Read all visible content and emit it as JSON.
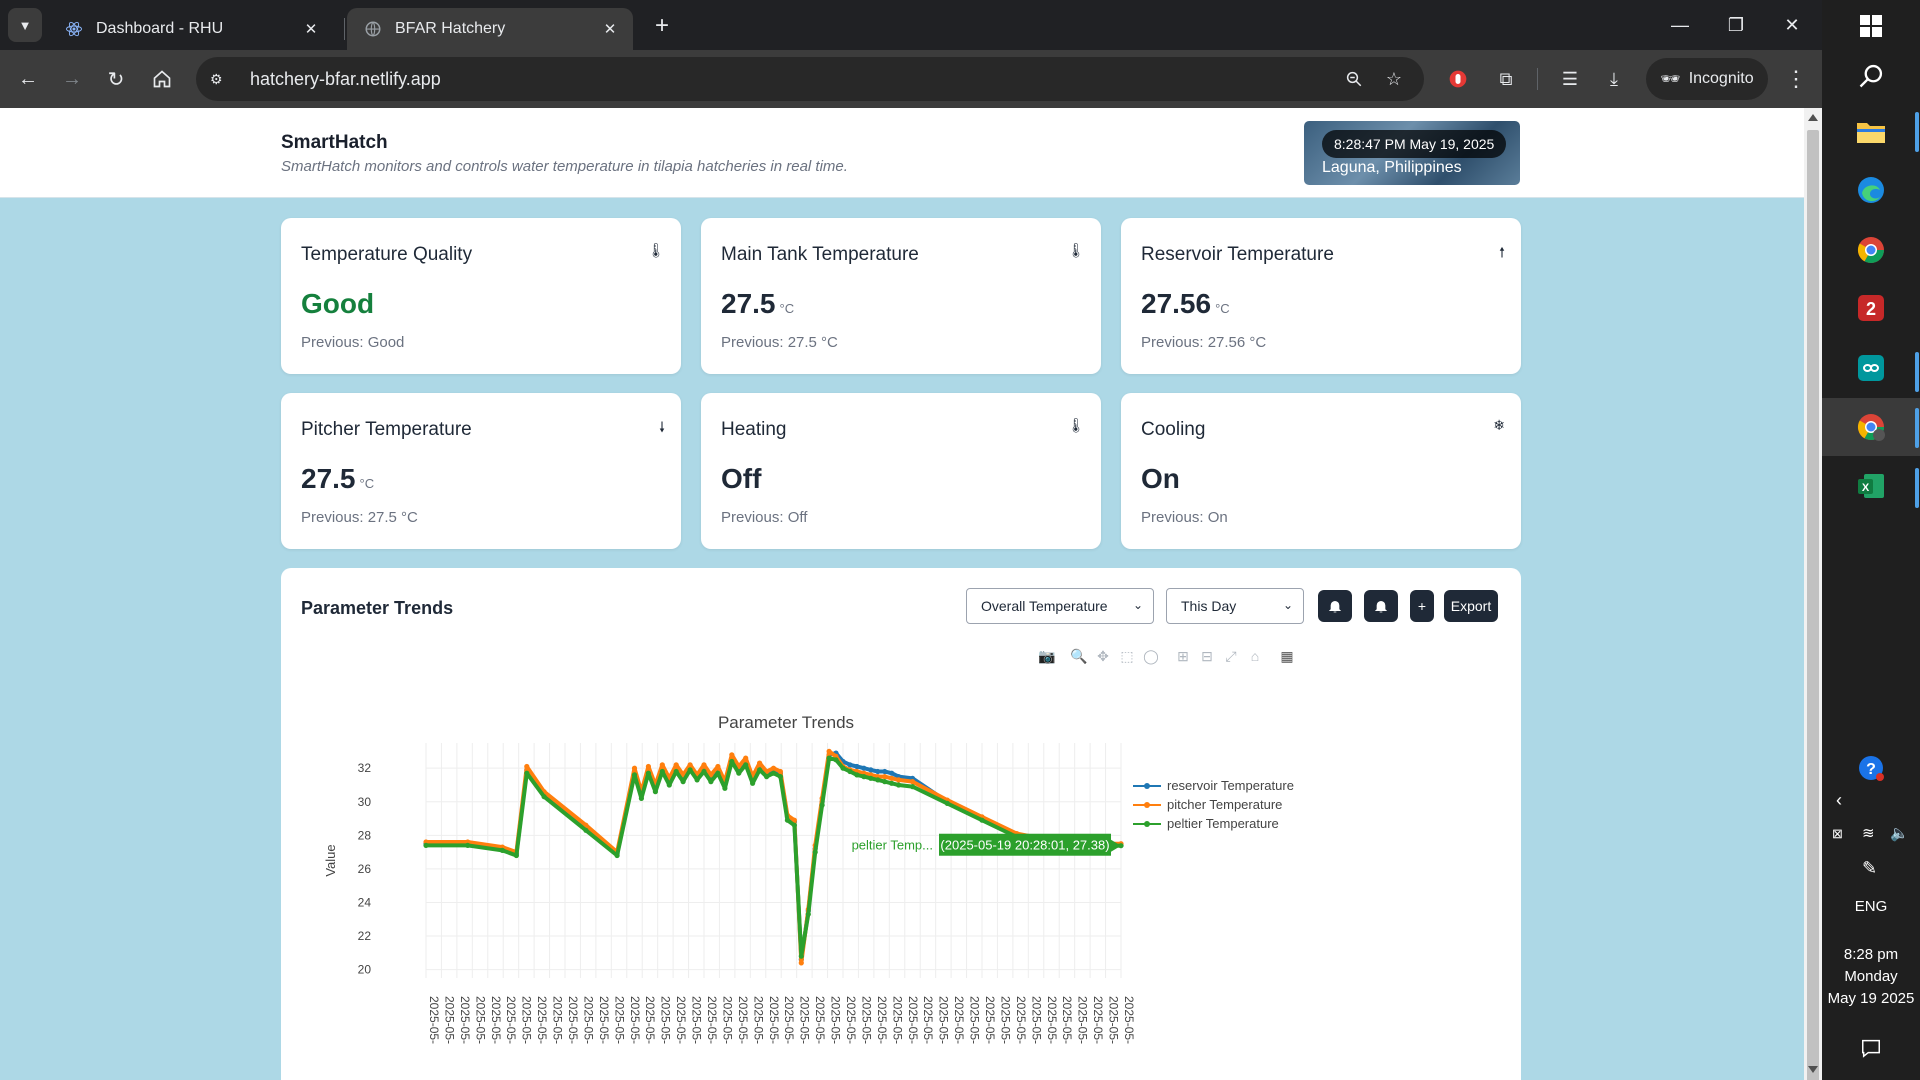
{
  "browser": {
    "tabs": [
      {
        "title": "Dashboard - RHU",
        "favicon": "react-icon"
      },
      {
        "title": "BFAR Hatchery",
        "favicon": "globe-icon"
      }
    ],
    "url": "hatchery-bfar.netlify.app",
    "profile_label": "Incognito"
  },
  "header": {
    "brand": "SmartHatch",
    "tagline": "SmartHatch monitors and controls water temperature in tilapia hatcheries in real time.",
    "datetime": "8:28:47 PM May 19, 2025",
    "location": "Laguna, Philippines"
  },
  "cards": [
    {
      "title": "Temperature Quality",
      "value": "Good",
      "unit": "",
      "previous": "Previous: Good",
      "icon": "thermometer-icon"
    },
    {
      "title": "Main Tank Temperature",
      "value": "27.5",
      "unit": "°C",
      "previous": "Previous: 27.5 °C",
      "icon": "thermometer-icon"
    },
    {
      "title": "Reservoir Temperature",
      "value": "27.56",
      "unit": "°C",
      "previous": "Previous: 27.56 °C",
      "icon": "arrow-up-icon"
    },
    {
      "title": "Pitcher Temperature",
      "value": "27.5",
      "unit": "°C",
      "previous": "Previous: 27.5 °C",
      "icon": "arrow-down-icon"
    },
    {
      "title": "Heating",
      "value": "Off",
      "unit": "",
      "previous": "Previous: Off",
      "icon": "heat-icon"
    },
    {
      "title": "Cooling",
      "value": "On",
      "unit": "",
      "previous": "Previous: On",
      "icon": "snowflake-icon"
    }
  ],
  "trends": {
    "title": "Parameter Trends",
    "parameter_select": "Overall Temperature",
    "range_select": "This Day",
    "add_label": "+",
    "export_label": "Export"
  },
  "chart_data": {
    "type": "line",
    "title": "Parameter Trends",
    "ylabel": "Value",
    "xlabel": "",
    "ylim": [
      19.5,
      33.5
    ],
    "yticks": [
      20,
      22,
      24,
      26,
      28,
      30,
      32
    ],
    "x_tick_label": "2025-05-",
    "x_tick_count": 46,
    "grid": true,
    "legend_position": "top-right",
    "x": [
      0,
      6,
      11,
      13,
      14.5,
      17,
      23,
      27.5,
      30,
      31,
      32,
      33,
      34,
      35,
      36,
      37,
      38,
      39,
      40,
      41,
      42,
      43,
      44,
      45,
      46,
      47,
      48,
      49,
      50,
      51,
      52,
      53,
      54,
      55,
      56,
      57,
      58,
      59,
      60,
      61,
      62,
      63,
      64,
      65,
      66,
      67,
      68,
      70,
      75,
      80,
      85,
      90,
      95,
      97.5,
      100
    ],
    "series": [
      {
        "name": "reservoir Temperature",
        "color": "#1f77b4",
        "values": [
          27.5,
          27.5,
          27.2,
          26.9,
          31.9,
          30.5,
          28.5,
          26.9,
          31.8,
          30.4,
          31.9,
          30.8,
          32.0,
          31.2,
          32.0,
          31.4,
          32.1,
          31.5,
          32.0,
          31.4,
          31.9,
          31.0,
          32.6,
          31.9,
          32.4,
          31.3,
          32.1,
          31.7,
          31.9,
          31.7,
          29.1,
          28.8,
          20.6,
          23.5,
          27.2,
          30.0,
          32.8,
          32.9,
          32.4,
          32.2,
          32.1,
          32.0,
          31.9,
          31.8,
          31.8,
          31.7,
          31.5,
          31.4,
          30.0,
          29.0,
          28.0,
          27.6,
          27.5,
          27.4,
          27.4
        ]
      },
      {
        "name": "pitcher Temperature",
        "color": "#ff7f0e",
        "values": [
          27.6,
          27.6,
          27.3,
          27.0,
          32.1,
          30.6,
          28.6,
          27.0,
          32.0,
          30.6,
          32.1,
          31.0,
          32.2,
          31.4,
          32.2,
          31.6,
          32.2,
          31.6,
          32.2,
          31.6,
          32.1,
          31.2,
          32.8,
          32.1,
          32.6,
          31.5,
          32.3,
          31.8,
          32.0,
          31.8,
          29.2,
          28.9,
          20.4,
          23.6,
          27.4,
          30.2,
          33.0,
          32.7,
          32.1,
          31.9,
          31.8,
          31.7,
          31.6,
          31.5,
          31.5,
          31.4,
          31.3,
          31.2,
          30.1,
          29.1,
          28.1,
          27.7,
          27.6,
          27.5,
          27.5
        ]
      },
      {
        "name": "peltier Temperature",
        "color": "#2ca02c",
        "values": [
          27.4,
          27.4,
          27.1,
          26.8,
          31.7,
          30.3,
          28.3,
          26.8,
          31.6,
          30.2,
          31.7,
          30.6,
          31.8,
          31.0,
          31.8,
          31.2,
          31.9,
          31.3,
          31.8,
          31.2,
          31.7,
          30.8,
          32.4,
          31.7,
          32.2,
          31.1,
          31.9,
          31.5,
          31.7,
          31.5,
          28.9,
          28.6,
          20.8,
          23.3,
          27.0,
          29.8,
          32.6,
          32.5,
          32.0,
          31.8,
          31.6,
          31.5,
          31.4,
          31.3,
          31.2,
          31.1,
          31.0,
          30.9,
          29.9,
          28.9,
          27.9,
          27.5,
          27.4,
          27.4,
          27.38
        ]
      }
    ],
    "hover": {
      "series_label": "peltier Temp...",
      "text": "(2025-05-19 20:28:01, 27.38)",
      "x": 100,
      "y": 27.38,
      "color": "#2ca02c"
    }
  },
  "taskbar": {
    "language": "ENG",
    "time": "8:28 pm",
    "day": "Monday",
    "date": "May 19 2025"
  }
}
